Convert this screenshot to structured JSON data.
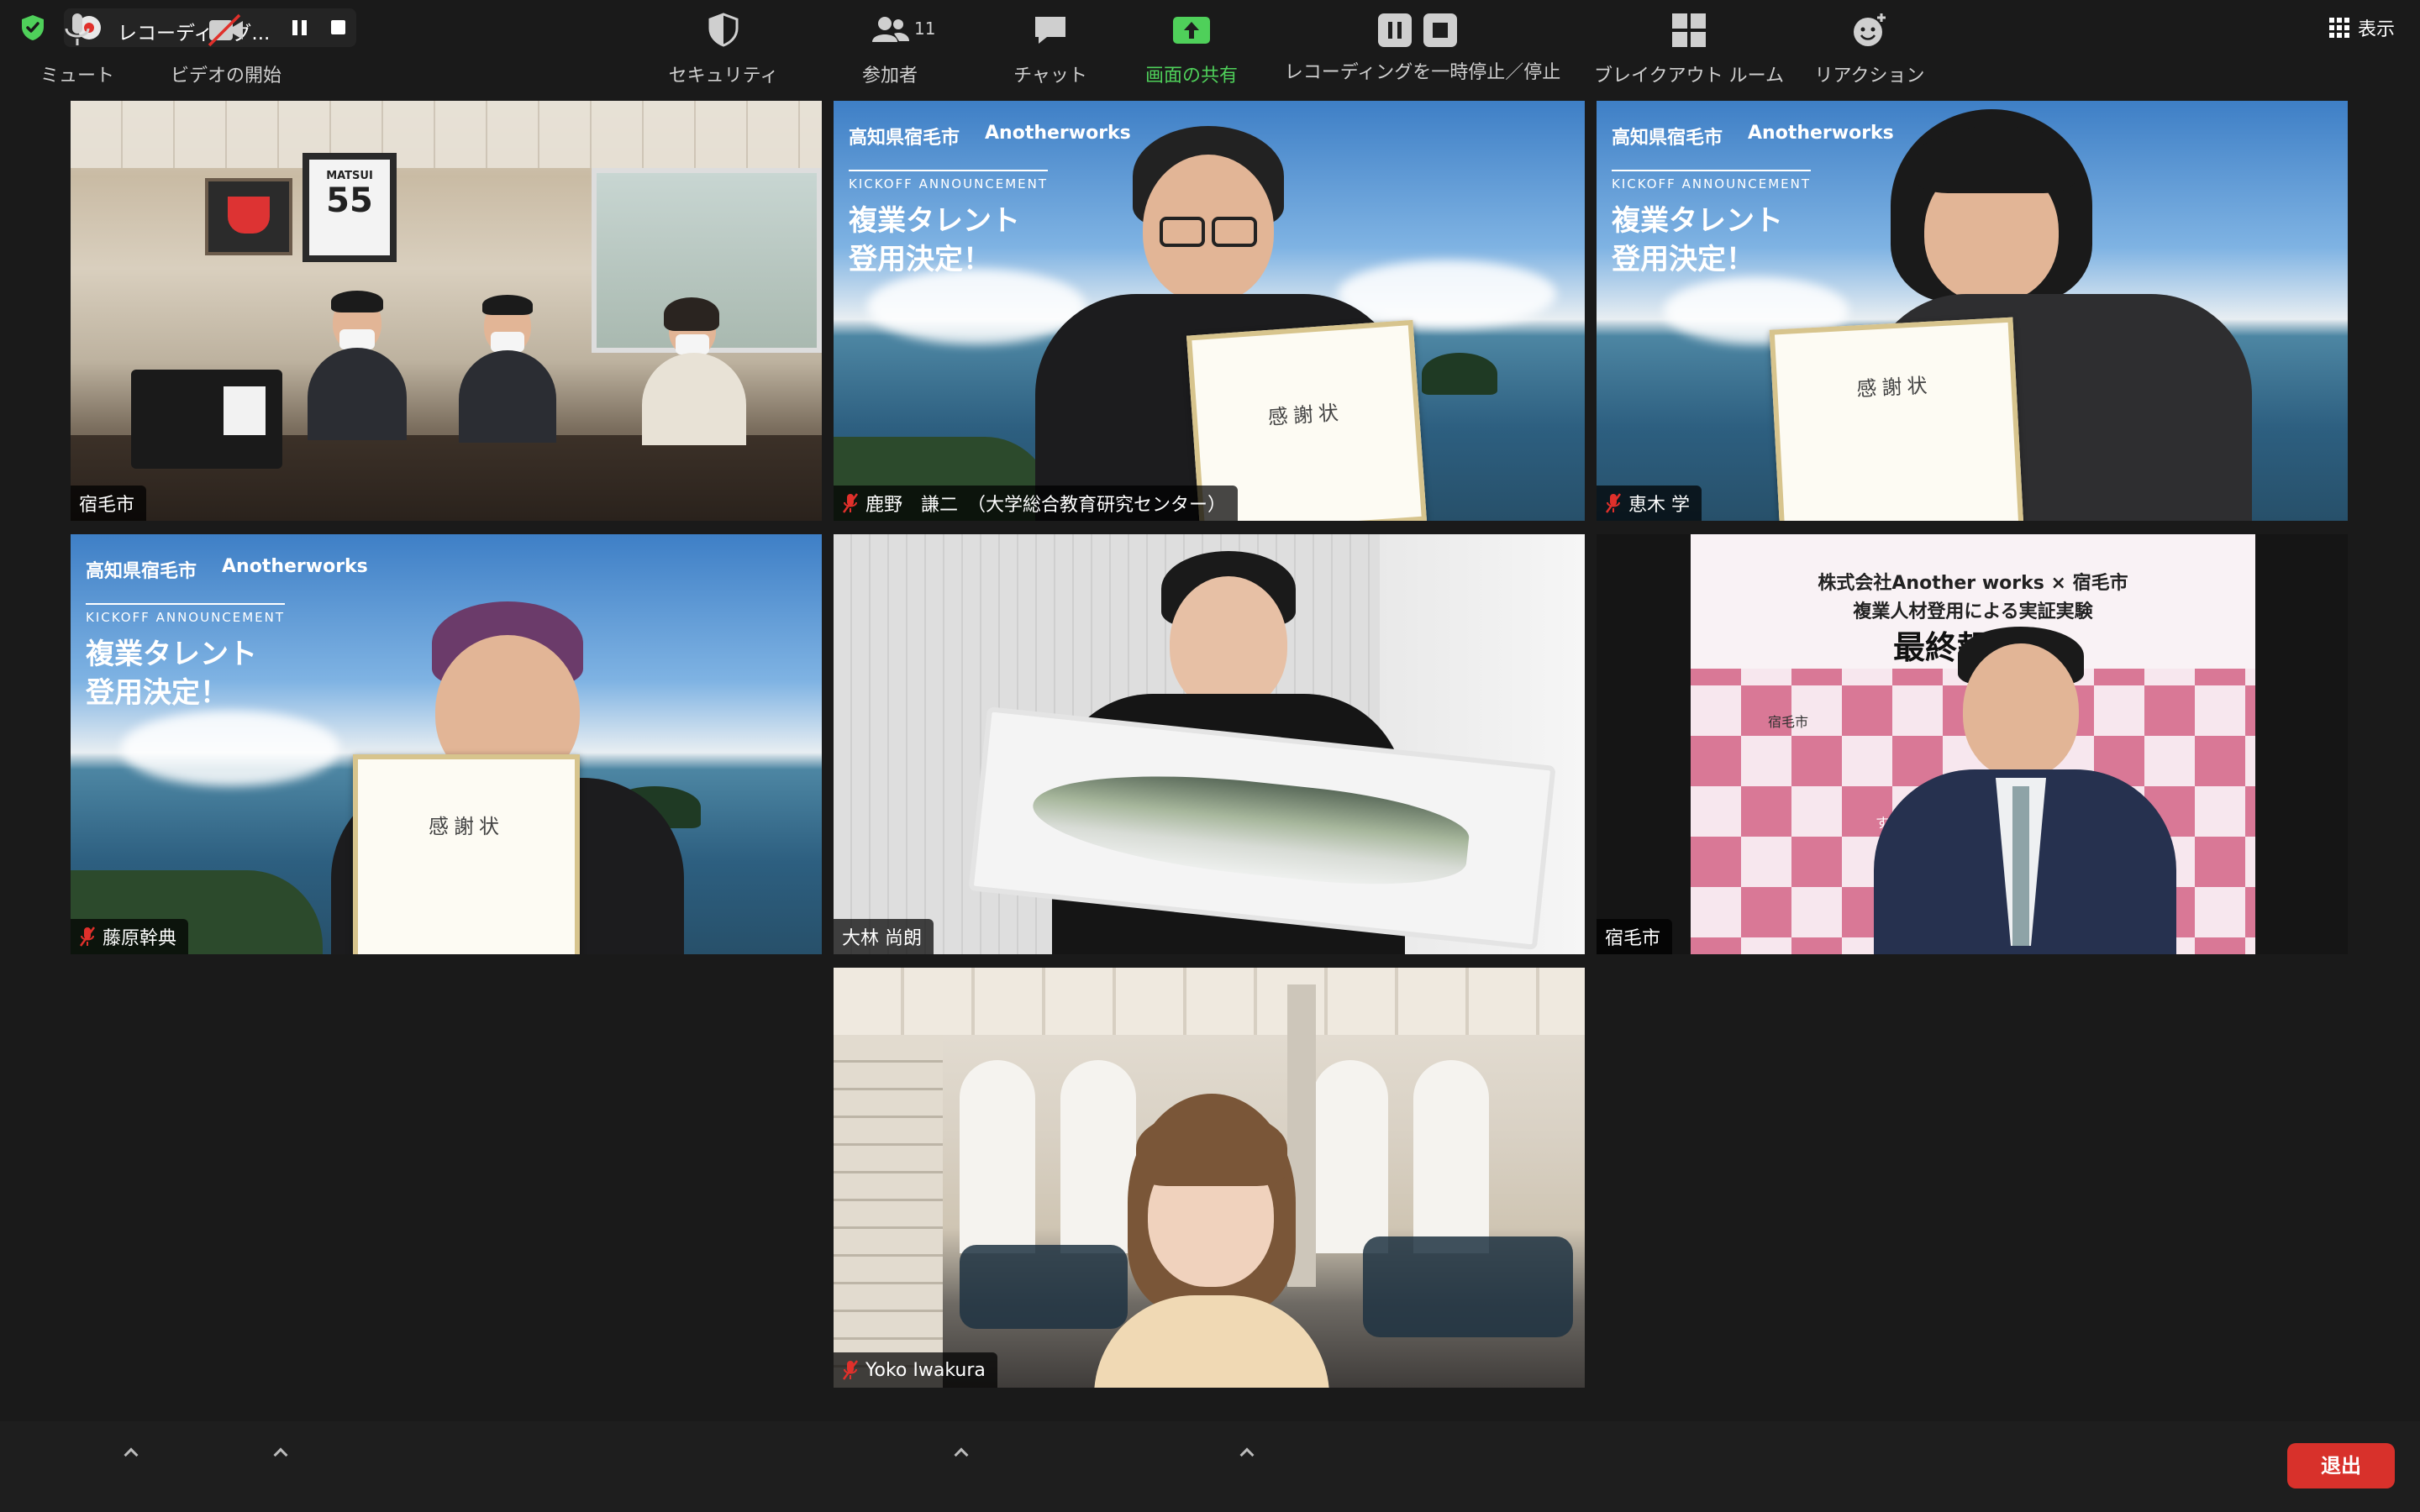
{
  "top_bar": {
    "recording_label": "レコーディング...",
    "view_label": "表示"
  },
  "tiles": [
    {
      "name": "宿毛市",
      "muted": false
    },
    {
      "name": "鹿野　謙二　（大学総合教育研究センター）",
      "muted": true
    },
    {
      "name": "恵木 学",
      "muted": true
    },
    {
      "name": "藤原幹典",
      "muted": true
    },
    {
      "name": "大林 尚朗",
      "muted": false,
      "active_speaker": true
    },
    {
      "name": "宿毛市",
      "muted": false
    },
    {
      "name": "Yoko Iwakura",
      "muted": true
    }
  ],
  "backgrounds": {
    "brand_city": "高知県宿毛市",
    "brand_company": "Anotherworks",
    "kickoff": "KICKOFF ANNOUNCEMENT",
    "headline_line1": "複業タレント",
    "headline_line2": "登用決定！",
    "certificate_title": "感謝状",
    "jersey_name": "MATSUI",
    "jersey_number": "55",
    "banner_line1": "株式会社Another works × 宿毛市",
    "banner_line2": "複業人材登用による実証実験",
    "banner_line3": "最終報告会",
    "banner_tile_text": "宿毛市",
    "banner_tile_text2": "すくも"
  },
  "toolbar": {
    "mute": "ミュート",
    "video": "ビデオの開始",
    "security": "セキュリティ",
    "participants": "参加者",
    "participants_count": "11",
    "chat": "チャット",
    "share": "画面の共有",
    "recording": "レコーディングを一時停止／停止",
    "breakout": "ブレイクアウト ルーム",
    "reactions": "リアクション",
    "end": "退出"
  },
  "colors": {
    "active_speaker_border": "#4fd05a",
    "share_green": "#4fd05a",
    "end_button": "#d8312b",
    "muted_red": "#e0302b"
  }
}
